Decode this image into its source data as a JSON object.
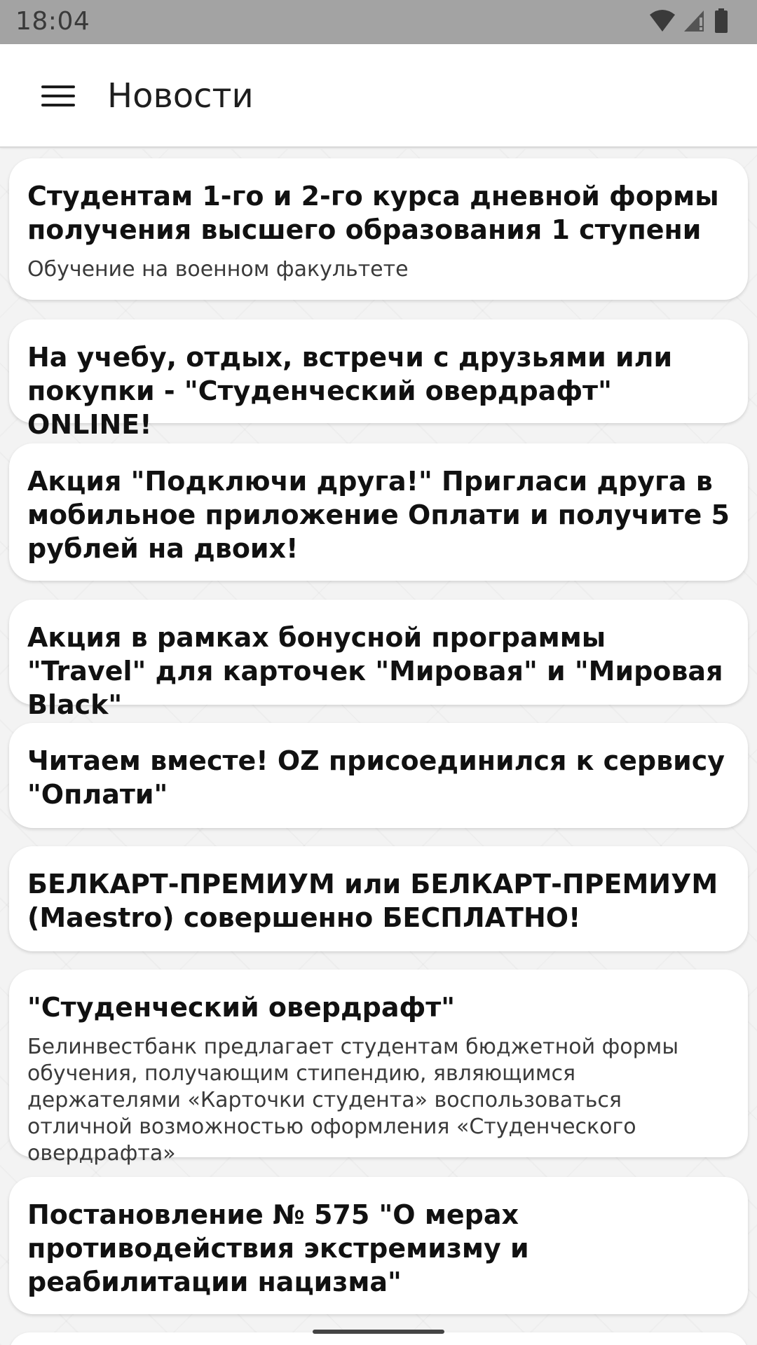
{
  "status_bar": {
    "time": "18:04",
    "icons": [
      "wifi-icon",
      "signal-icon",
      "battery-icon"
    ]
  },
  "app_bar": {
    "title": "Новости",
    "menu_icon": "hamburger-menu-icon"
  },
  "news": [
    {
      "title": "Студентам 1-го и 2-го курса дневной формы получения высшего образования 1 ступени",
      "subtitle": "Обучение на военном факультете"
    },
    {
      "title": "На учебу, отдых, встречи с друзьями или покупки - \"Студенческий овердрафт\" ONLINE!",
      "subtitle": ""
    },
    {
      "title": "Акция \"Подключи друга!\" Пригласи друга в мобильное приложение Оплати и получите 5 рублей на двоих!",
      "subtitle": ""
    },
    {
      "title": "Акция в рамках бонусной программы \"Travel\" для карточек \"Мировая\" и \"Мировая Black\"",
      "subtitle": ""
    },
    {
      "title": "Читаем вместе! OZ присоединился к сервису \"Оплати\"",
      "subtitle": ""
    },
    {
      "title": "БЕЛКАРТ-ПРЕМИУМ или БЕЛКАРТ-ПРЕМИУМ (Maestro) совершенно БЕСПЛАТНО!",
      "subtitle": ""
    },
    {
      "title": "\"Студенческий овердрафт\"",
      "subtitle": "Белинвестбанк предлагает студентам бюджетной формы обучения, получающим стипендию, являющимся держателями «Карточки студента» воспользоваться отличной возможностью оформления «Студенческого овердрафта»"
    },
    {
      "title": "Постановление № 575 \"О мерах противодействия экстремизму и реабилитации нацизма\"",
      "subtitle": ""
    }
  ],
  "colors": {
    "status_bar": "#a3a3a3",
    "background": "#f3f3f3",
    "card": "#ffffff",
    "title_text": "#111111"
  }
}
